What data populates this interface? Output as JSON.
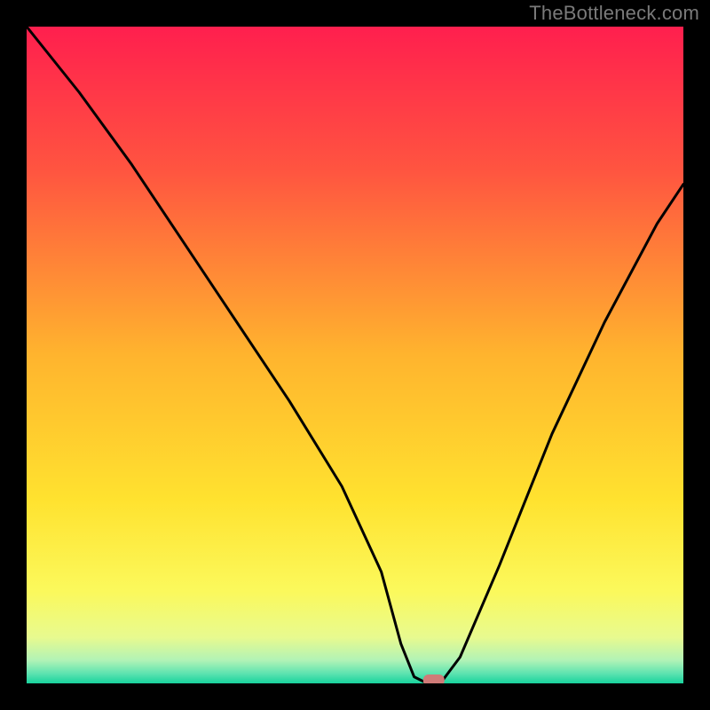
{
  "watermark": "TheBottleneck.com",
  "chart_data": {
    "type": "line",
    "title": "",
    "xlabel": "",
    "ylabel": "",
    "xlim": [
      0,
      100
    ],
    "ylim": [
      0,
      100
    ],
    "grid": false,
    "legend": false,
    "series": [
      {
        "name": "bottleneck-curve",
        "color": "#000000",
        "x": [
          0,
          8,
          16,
          24,
          32,
          40,
          48,
          54,
          57,
          59,
          61,
          63,
          66,
          72,
          80,
          88,
          96,
          100
        ],
        "values": [
          100,
          90,
          79,
          67,
          55,
          43,
          30,
          17,
          6,
          1,
          0,
          0,
          4,
          18,
          38,
          55,
          70,
          76
        ]
      }
    ],
    "marker": {
      "name": "optimal-point",
      "x": 62,
      "y": 0,
      "color": "#cf7b78"
    },
    "background": {
      "type": "vertical-gradient",
      "stops": [
        {
          "offset": 0.0,
          "color": "#ff1f4e"
        },
        {
          "offset": 0.22,
          "color": "#ff5540"
        },
        {
          "offset": 0.5,
          "color": "#ffb42e"
        },
        {
          "offset": 0.72,
          "color": "#ffe22f"
        },
        {
          "offset": 0.86,
          "color": "#fbf95c"
        },
        {
          "offset": 0.93,
          "color": "#e8fa8f"
        },
        {
          "offset": 0.965,
          "color": "#b1f3b6"
        },
        {
          "offset": 0.985,
          "color": "#5de3b0"
        },
        {
          "offset": 1.0,
          "color": "#18d39d"
        }
      ]
    }
  }
}
